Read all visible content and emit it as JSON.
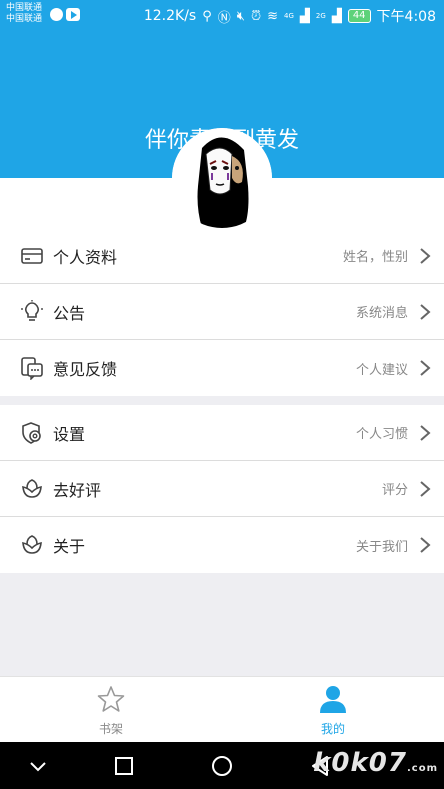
{
  "status_bar": {
    "carrier_1": "中国联通",
    "carrier_2": "中国联通",
    "speed": "12.2K/s",
    "net_4g": "4G",
    "net_2g": "2G",
    "battery": "44",
    "time": "下午4:08"
  },
  "header": {
    "slogan": "伴你青丝到黄发"
  },
  "menu_group_1": [
    {
      "label": "个人资料",
      "hint": "姓名，性别",
      "icon": "card-icon"
    },
    {
      "label": "公告",
      "hint": "系统消息",
      "icon": "bulb-icon"
    },
    {
      "label": "意见反馈",
      "hint": "个人建议",
      "icon": "feedback-icon"
    }
  ],
  "menu_group_2": [
    {
      "label": "设置",
      "hint": "个人习惯",
      "icon": "settings-shield-icon"
    },
    {
      "label": "去好评",
      "hint": "评分",
      "icon": "lotus-icon"
    },
    {
      "label": "关于",
      "hint": "关于我们",
      "icon": "lotus-icon"
    }
  ],
  "tabbar": {
    "tabs": [
      {
        "label": "书架",
        "icon": "star-icon",
        "active": false
      },
      {
        "label": "我的",
        "icon": "person-icon",
        "active": true
      }
    ],
    "active_color": "#1fa5e6",
    "inactive_color": "#888888"
  },
  "watermark": {
    "main": "k0k07",
    "sub": ".com"
  },
  "colors": {
    "accent": "#1fa5e6",
    "background": "#eeeef2"
  }
}
